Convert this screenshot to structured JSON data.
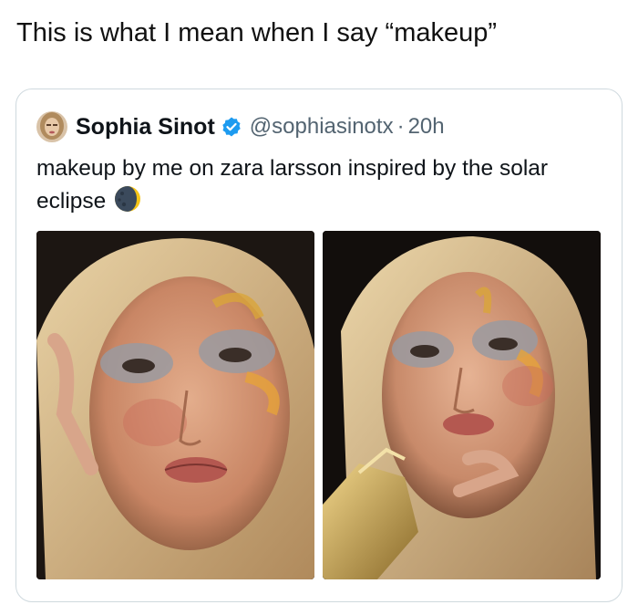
{
  "caption": "This is what I mean when I say “makeup”",
  "tweet": {
    "display_name": "Sophia Sinot",
    "handle": "@sophiasinotx",
    "separator": "·",
    "time": "20h",
    "text": "makeup by me on zara larsson inspired by the solar eclipse",
    "emoji_icon": "new-moon-face-icon",
    "verified_icon": "verified-badge-icon"
  },
  "photos": [
    {
      "name": "photo-left",
      "description_icon": "portrait-photo-icon"
    },
    {
      "name": "photo-right",
      "description_icon": "portrait-photo-icon"
    }
  ],
  "colors": {
    "verified_blue": "#1d9bf0",
    "muted_text": "#536471",
    "border": "#cfd9de"
  }
}
